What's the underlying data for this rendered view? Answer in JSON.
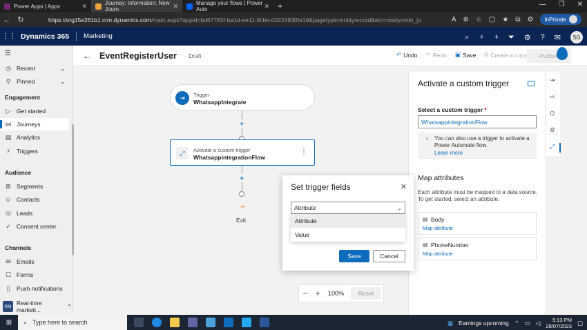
{
  "browser": {
    "tabs": [
      {
        "title": "Power Apps | Apps",
        "color": "#742774"
      },
      {
        "title": "Journey: Information: New Journ",
        "color": "#e8a33d"
      },
      {
        "title": "Manage your flows | Power Auto",
        "color": "#0066ff"
      }
    ],
    "url_host": "https://org15e261b1.crm.dynamics.com",
    "url_path": "/main.aspx?appid=bd67783f-ba1d-ee11-9cbe-00224830fe19&pagetype=entityrecord&etn=msdynmkt_journey",
    "inprivate_label": "InPrivate",
    "profile_initials": "SG"
  },
  "header": {
    "brand": "Dynamics 365",
    "area": "Marketing",
    "user_initials": "SG"
  },
  "leftnav": {
    "items": [
      {
        "label": "Recent",
        "icon": "clock-icon"
      },
      {
        "label": "Pinned",
        "icon": "pin-icon"
      }
    ],
    "sections": [
      {
        "title": "Engagement",
        "items": [
          "Get started",
          "Journeys",
          "Analytics",
          "Triggers"
        ]
      },
      {
        "title": "Audience",
        "items": [
          "Segments",
          "Contacts",
          "Leads",
          "Consent center"
        ]
      },
      {
        "title": "Channels",
        "items": [
          "Emails",
          "Forms",
          "Push notifications"
        ]
      }
    ],
    "area_switcher": {
      "initials": "RM",
      "label": "Real-time marketi..."
    }
  },
  "command_bar": {
    "record_title": "EventRegisterUser",
    "status": "Draft",
    "undo": "Undo",
    "redo": "Redo",
    "save": "Save",
    "copy": "Create a copy",
    "publish": "Publish"
  },
  "canvas": {
    "trigger_node": {
      "subtitle": "Trigger",
      "title": "WhatsappIntegrate"
    },
    "action_node": {
      "subtitle": "Activate a custom trigger",
      "title": "WhatsappintegrationFlow"
    },
    "exit_label": "Exit",
    "zoom": "100%",
    "reset": "Reset"
  },
  "dialog": {
    "title": "Set trigger fields",
    "select_value": "Attribute",
    "options": [
      "Attribute",
      "Value"
    ],
    "save": "Save",
    "cancel": "Cancel"
  },
  "right_panel": {
    "title": "Activate a custom trigger",
    "select_label": "Select a custom trigger",
    "select_value": "WhatsappintegrationFlow",
    "info_text": "You can also use a trigger to activate a Power Automate flow.",
    "info_link": "Learn more",
    "map_title": "Map attributes",
    "map_desc": "Each attribute must be mapped to a data source. To get started, select an attribute.",
    "attributes": [
      {
        "name": "Body",
        "link": "Map attribute"
      },
      {
        "name": "PhoneNumber",
        "link": "Map attribute"
      }
    ]
  },
  "taskbar": {
    "search_placeholder": "Type here to search",
    "weather": "Earnings upcoming",
    "time": "5:13 PM",
    "date": "28/07/2023"
  }
}
